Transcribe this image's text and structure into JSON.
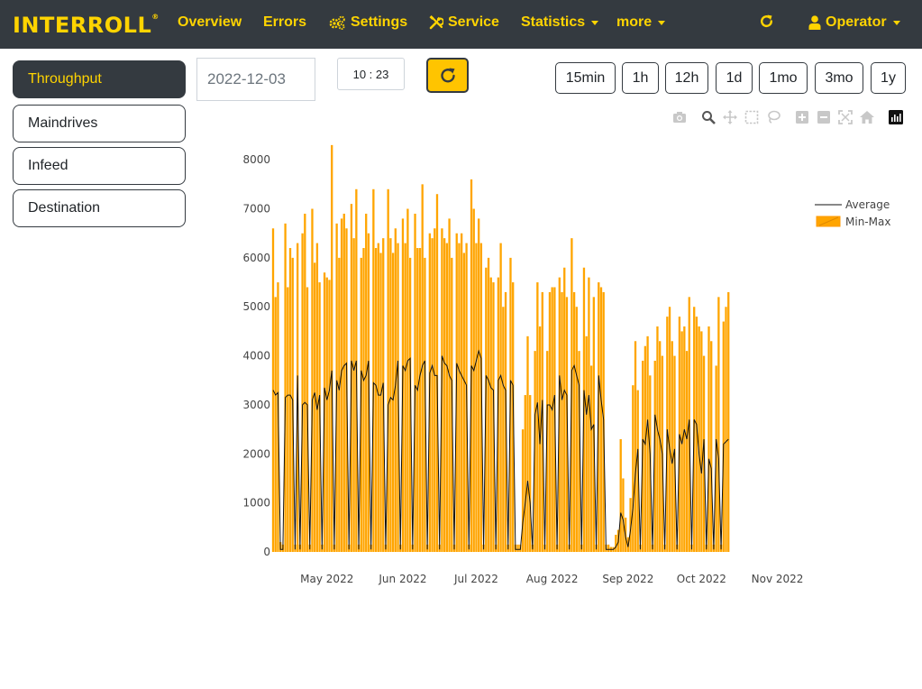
{
  "brand": {
    "name": "INTERROLL",
    "mark": "®"
  },
  "nav": {
    "overview": "Overview",
    "errors": "Errors",
    "settings": "Settings",
    "service": "Service",
    "statistics": "Statistics",
    "more": "more",
    "operator": "Operator"
  },
  "sidebar": {
    "items": [
      {
        "label": "Throughput",
        "active": true
      },
      {
        "label": "Maindrives",
        "active": false
      },
      {
        "label": "Infeed",
        "active": false
      },
      {
        "label": "Destination",
        "active": false
      }
    ]
  },
  "controls": {
    "date": "2022-12-03",
    "time": "10 : 23"
  },
  "ranges": [
    "15min",
    "1h",
    "12h",
    "1d",
    "1mo",
    "3mo",
    "1y"
  ],
  "modebar_icons": [
    "camera-icon",
    "zoom-icon",
    "pan-icon",
    "box-select-icon",
    "lasso-select-icon",
    "zoom-in-icon",
    "zoom-out-icon",
    "autoscale-icon",
    "reset-axes-icon",
    "plotly-logo-icon"
  ],
  "colors": {
    "navbar": "#343a40",
    "accent": "#ffd400",
    "bars": "#ffa500",
    "line": "#000000"
  },
  "chart_data": {
    "type": "bar",
    "legend_position": "top-right",
    "x_ticks": [
      "May 2022",
      "Jun 2022",
      "Jul 2022",
      "Aug 2022",
      "Sep 2022",
      "Oct 2022",
      "Nov 2022"
    ],
    "y_ticks": [
      "0",
      "1000",
      "2000",
      "3000",
      "4000",
      "5000",
      "6000",
      "7000",
      "8000"
    ],
    "xlim": [
      "2022-04-09",
      "2022-11-10"
    ],
    "ylim": [
      0,
      8500
    ],
    "grid": false,
    "series": [
      {
        "name": "Average",
        "type": "line"
      },
      {
        "name": "Min-Max",
        "type": "bar"
      }
    ],
    "points": [
      [
        "2022-04-09",
        6600,
        3300
      ],
      [
        "2022-04-10",
        5200,
        3200
      ],
      [
        "2022-04-11",
        5500,
        3250
      ],
      [
        "2022-04-12",
        200,
        50
      ],
      [
        "2022-04-13",
        150,
        50
      ],
      [
        "2022-04-14",
        6700,
        3150
      ],
      [
        "2022-04-15",
        5400,
        3200
      ],
      [
        "2022-04-16",
        6200,
        3200
      ],
      [
        "2022-04-17",
        6000,
        3100
      ],
      [
        "2022-04-18",
        150,
        50
      ],
      [
        "2022-04-19",
        6300,
        3600
      ],
      [
        "2022-04-20",
        150,
        50
      ],
      [
        "2022-04-21",
        6500,
        3000
      ],
      [
        "2022-04-22",
        6900,
        3050
      ],
      [
        "2022-04-23",
        5400,
        3000
      ],
      [
        "2022-04-24",
        150,
        50
      ],
      [
        "2022-04-25",
        7000,
        3100
      ],
      [
        "2022-04-26",
        5900,
        3250
      ],
      [
        "2022-04-27",
        6300,
        2900
      ],
      [
        "2022-04-28",
        5500,
        3200
      ],
      [
        "2022-04-29",
        150,
        50
      ],
      [
        "2022-04-30",
        5700,
        3350
      ],
      [
        "2022-05-01",
        5600,
        3100
      ],
      [
        "2022-05-02",
        5550,
        3300
      ],
      [
        "2022-05-03",
        8300,
        3700
      ],
      [
        "2022-05-04",
        150,
        50
      ],
      [
        "2022-05-05",
        6700,
        3500
      ],
      [
        "2022-05-06",
        6000,
        3300
      ],
      [
        "2022-05-07",
        6800,
        3700
      ],
      [
        "2022-05-08",
        6900,
        3800
      ],
      [
        "2022-05-09",
        6600,
        3850
      ],
      [
        "2022-05-10",
        150,
        50
      ],
      [
        "2022-05-11",
        7100,
        3900
      ],
      [
        "2022-05-12",
        6400,
        3700
      ],
      [
        "2022-05-13",
        7400,
        3900
      ],
      [
        "2022-05-14",
        150,
        50
      ],
      [
        "2022-05-15",
        6000,
        3700
      ],
      [
        "2022-05-16",
        6200,
        3500
      ],
      [
        "2022-05-17",
        6900,
        3600
      ],
      [
        "2022-05-18",
        6500,
        3900
      ],
      [
        "2022-05-19",
        150,
        50
      ],
      [
        "2022-05-20",
        7400,
        3450
      ],
      [
        "2022-05-21",
        6200,
        3400
      ],
      [
        "2022-05-22",
        6300,
        3200
      ],
      [
        "2022-05-23",
        6100,
        3200
      ],
      [
        "2022-05-24",
        6400,
        3450
      ],
      [
        "2022-05-25",
        150,
        50
      ],
      [
        "2022-05-26",
        7400,
        3000
      ],
      [
        "2022-05-27",
        6400,
        3150
      ],
      [
        "2022-05-28",
        6100,
        3100
      ],
      [
        "2022-05-29",
        6600,
        3400
      ],
      [
        "2022-05-30",
        6300,
        3900
      ],
      [
        "2022-05-31",
        150,
        50
      ],
      [
        "2022-06-01",
        6800,
        3800
      ],
      [
        "2022-06-02",
        6300,
        3700
      ],
      [
        "2022-06-03",
        7000,
        3900
      ],
      [
        "2022-06-04",
        6000,
        3950
      ],
      [
        "2022-06-05",
        150,
        50
      ],
      [
        "2022-06-06",
        6900,
        3400
      ],
      [
        "2022-06-07",
        6200,
        3300
      ],
      [
        "2022-06-08",
        6200,
        3600
      ],
      [
        "2022-06-09",
        7500,
        3800
      ],
      [
        "2022-06-10",
        6000,
        3900
      ],
      [
        "2022-06-11",
        150,
        50
      ],
      [
        "2022-06-12",
        6500,
        3650
      ],
      [
        "2022-06-13",
        6400,
        3800
      ],
      [
        "2022-06-14",
        6600,
        3600
      ],
      [
        "2022-06-15",
        7300,
        3600
      ],
      [
        "2022-06-16",
        150,
        50
      ],
      [
        "2022-06-17",
        6600,
        4000
      ],
      [
        "2022-06-18",
        6400,
        3850
      ],
      [
        "2022-06-19",
        6300,
        3800
      ],
      [
        "2022-06-20",
        6800,
        3600
      ],
      [
        "2022-06-21",
        6000,
        3500
      ],
      [
        "2022-06-22",
        150,
        50
      ],
      [
        "2022-06-23",
        6500,
        3850
      ],
      [
        "2022-06-24",
        6300,
        3700
      ],
      [
        "2022-06-25",
        6500,
        3600
      ],
      [
        "2022-06-26",
        6100,
        3500
      ],
      [
        "2022-06-27",
        6300,
        3400
      ],
      [
        "2022-06-28",
        150,
        50
      ],
      [
        "2022-06-29",
        7600,
        3800
      ],
      [
        "2022-06-30",
        7000,
        3700
      ],
      [
        "2022-07-01",
        6300,
        3900
      ],
      [
        "2022-07-02",
        6800,
        4100
      ],
      [
        "2022-07-03",
        6300,
        3950
      ],
      [
        "2022-07-04",
        150,
        50
      ],
      [
        "2022-07-05",
        5800,
        3600
      ],
      [
        "2022-07-06",
        6000,
        3500
      ],
      [
        "2022-07-07",
        5600,
        3350
      ],
      [
        "2022-07-08",
        5500,
        3300
      ],
      [
        "2022-07-09",
        150,
        50
      ],
      [
        "2022-07-10",
        5600,
        3500
      ],
      [
        "2022-07-11",
        6300,
        3600
      ],
      [
        "2022-07-12",
        5000,
        3400
      ],
      [
        "2022-07-13",
        5300,
        3300
      ],
      [
        "2022-07-14",
        150,
        50
      ],
      [
        "2022-07-15",
        6000,
        3500
      ],
      [
        "2022-07-16",
        5500,
        3400
      ],
      [
        "2022-07-17",
        150,
        50
      ],
      [
        "2022-07-18",
        150,
        50
      ],
      [
        "2022-07-19",
        150,
        50
      ],
      [
        "2022-07-20",
        2500,
        600
      ],
      [
        "2022-07-21",
        3200,
        1000
      ],
      [
        "2022-07-22",
        4400,
        1450
      ],
      [
        "2022-07-23",
        3200,
        1000
      ],
      [
        "2022-07-24",
        150,
        50
      ],
      [
        "2022-07-25",
        4100,
        2800
      ],
      [
        "2022-07-26",
        5500,
        3050
      ],
      [
        "2022-07-27",
        4600,
        2200
      ],
      [
        "2022-07-28",
        5300,
        3100
      ],
      [
        "2022-07-29",
        150,
        50
      ],
      [
        "2022-07-30",
        4100,
        3000
      ],
      [
        "2022-07-31",
        5300,
        3000
      ],
      [
        "2022-08-01",
        5400,
        2900
      ],
      [
        "2022-08-02",
        5400,
        3200
      ],
      [
        "2022-08-03",
        150,
        50
      ],
      [
        "2022-08-04",
        5600,
        3600
      ],
      [
        "2022-08-05",
        5300,
        3100
      ],
      [
        "2022-08-06",
        5800,
        3300
      ],
      [
        "2022-08-07",
        5200,
        3200
      ],
      [
        "2022-08-08",
        150,
        50
      ],
      [
        "2022-08-09",
        6400,
        3700
      ],
      [
        "2022-08-10",
        5300,
        3800
      ],
      [
        "2022-08-11",
        5000,
        3600
      ],
      [
        "2022-08-12",
        4100,
        3400
      ],
      [
        "2022-08-13",
        150,
        50
      ],
      [
        "2022-08-14",
        5800,
        3300
      ],
      [
        "2022-08-15",
        4400,
        2800
      ],
      [
        "2022-08-16",
        5600,
        3200
      ],
      [
        "2022-08-17",
        3800,
        2500
      ],
      [
        "2022-08-18",
        5200,
        2600
      ],
      [
        "2022-08-19",
        150,
        50
      ],
      [
        "2022-08-20",
        5500,
        3600
      ],
      [
        "2022-08-21",
        5400,
        3100
      ],
      [
        "2022-08-22",
        5300,
        2700
      ],
      [
        "2022-08-23",
        150,
        50
      ],
      [
        "2022-08-24",
        150,
        50
      ],
      [
        "2022-08-25",
        100,
        50
      ],
      [
        "2022-08-26",
        100,
        50
      ],
      [
        "2022-08-27",
        350,
        100
      ],
      [
        "2022-08-28",
        450,
        200
      ],
      [
        "2022-08-29",
        2300,
        800
      ],
      [
        "2022-08-30",
        1500,
        650
      ],
      [
        "2022-08-31",
        700,
        300
      ],
      [
        "2022-09-01",
        300,
        100
      ],
      [
        "2022-09-02",
        1100,
        450
      ],
      [
        "2022-09-03",
        3400,
        900
      ],
      [
        "2022-09-04",
        4300,
        1600
      ],
      [
        "2022-09-05",
        3300,
        2100
      ],
      [
        "2022-09-06",
        150,
        50
      ],
      [
        "2022-09-07",
        3900,
        2300
      ],
      [
        "2022-09-08",
        4200,
        2200
      ],
      [
        "2022-09-09",
        4400,
        2700
      ],
      [
        "2022-09-10",
        3600,
        2000
      ],
      [
        "2022-09-11",
        150,
        50
      ],
      [
        "2022-09-12",
        3900,
        2800
      ],
      [
        "2022-09-13",
        4600,
        2500
      ],
      [
        "2022-09-14",
        4300,
        2300
      ],
      [
        "2022-09-15",
        4000,
        2000
      ],
      [
        "2022-09-16",
        150,
        50
      ],
      [
        "2022-09-17",
        4800,
        2500
      ],
      [
        "2022-09-18",
        5000,
        2100
      ],
      [
        "2022-09-19",
        4300,
        1800
      ],
      [
        "2022-09-20",
        4000,
        2100
      ],
      [
        "2022-09-21",
        150,
        50
      ],
      [
        "2022-09-22",
        4800,
        2400
      ],
      [
        "2022-09-23",
        4500,
        2200
      ],
      [
        "2022-09-24",
        4600,
        2500
      ],
      [
        "2022-09-25",
        4100,
        2300
      ],
      [
        "2022-09-26",
        5200,
        2700
      ],
      [
        "2022-09-27",
        150,
        50
      ],
      [
        "2022-09-28",
        5000,
        2700
      ],
      [
        "2022-09-29",
        4800,
        2600
      ],
      [
        "2022-09-30",
        4600,
        2000
      ],
      [
        "2022-10-01",
        4500,
        1600
      ],
      [
        "2022-10-02",
        4000,
        2300
      ],
      [
        "2022-10-03",
        150,
        50
      ],
      [
        "2022-10-04",
        4600,
        1900
      ],
      [
        "2022-10-05",
        4300,
        1700
      ],
      [
        "2022-10-06",
        150,
        50
      ],
      [
        "2022-10-07",
        3800,
        2300
      ],
      [
        "2022-10-08",
        5200,
        1900
      ],
      [
        "2022-10-09",
        150,
        50
      ],
      [
        "2022-10-10",
        4700,
        2200
      ],
      [
        "2022-10-11",
        5000,
        2250
      ],
      [
        "2022-10-12",
        5300,
        2300
      ]
    ]
  }
}
